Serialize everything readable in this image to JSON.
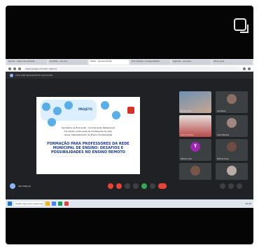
{
  "browser": {
    "tabs": [
      {
        "label": "Gmail - Caixa de entrada",
        "active": false
      },
      {
        "label": "YouTube - Ao vivo",
        "active": false
      },
      {
        "label": "Meet - apresentação",
        "active": true
      },
      {
        "label": "Documento compartilhado",
        "active": false
      },
      {
        "label": "Agenda - eventos",
        "active": false
      },
      {
        "label": "Nova guia",
        "active": false
      }
    ],
    "url": "meet.google.com/abc-defg-hij"
  },
  "meet": {
    "top_label": "Você está apresentando para todos",
    "meeting_name": "abc-defg-hij",
    "slide": {
      "title": "PROJETO",
      "lines": [
        "Secretaria de Educação - Coordenação Pedagógica",
        "Formação continuada de professores da rede",
        "Apoio: Departamento de Ensino Fundamental"
      ],
      "heading": "FORMAÇÃO PARA PROFESSORES DA REDE MUNICIPAL DE ENSINO: DESAFIOS E POSSIBILIDADES NO ENSINO REMOTO"
    },
    "participants": [
      {
        "name": "Maria Souza"
      },
      {
        "name": "Ana Paula"
      },
      {
        "name": "Juliana Ferreira"
      },
      {
        "name": "Carla Mendes"
      },
      {
        "name": "Tatiane Lima",
        "initial": "T"
      },
      {
        "name": "Patrícia Alves"
      },
      {
        "name": "Fernanda Costa"
      },
      {
        "name": "Você"
      }
    ]
  },
  "taskbar": {
    "search_placeholder": "Digite aqui para pesquisar",
    "clock": "10:42"
  },
  "colors": {
    "frame": "#050505",
    "meet_bg": "#202124",
    "end_call": "#ea4335",
    "accent": "#8ab4f8"
  }
}
